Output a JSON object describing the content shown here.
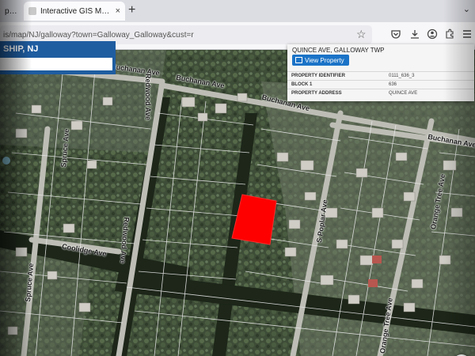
{
  "browser": {
    "tabs": [
      {
        "label": "pal Co"
      },
      {
        "label": "Interactive GIS Map of GALLOW",
        "close": "×"
      }
    ],
    "new_tab": "+",
    "tab_list": "⌄",
    "url": "is/map/NJ/galloway?town=Galloway_Galloway&cust=r",
    "star": "☆"
  },
  "header": {
    "title": "SHIP, NJ"
  },
  "popup": {
    "title": "QUINCE AVE, GALLOWAY TWP",
    "view_button": "View Property",
    "rows": [
      {
        "label": "PROPERTY IDENTIFIER",
        "value": "0111_636_3"
      },
      {
        "label": "BLOCK 1",
        "value": "636"
      },
      {
        "label": "PROPERTY ADDRESS",
        "value": "QUINCE AVE"
      }
    ]
  },
  "streets": {
    "buchanan_1": "Buchanan Ave",
    "buchanan_2": "Buchanan Ave",
    "buchanan_3": "Buchanan Ave",
    "buchanan_4": "Buchanan Ave",
    "redwood_1": "Redwood Ave",
    "redwood_2": "Redwood Ave",
    "spruce_1": "Spruce Ave",
    "spruce_2": "Spruce Ave",
    "coolidge": "Coolidge Ave",
    "poplar": "S Poplar Ave",
    "orange_1": "Orange Tree Ave",
    "orange_2": "Orange Tree Ave"
  },
  "colors": {
    "selected_parcel": "#ff0000",
    "header_bg": "#1f5da1",
    "button_bg": "#1a73c7"
  }
}
